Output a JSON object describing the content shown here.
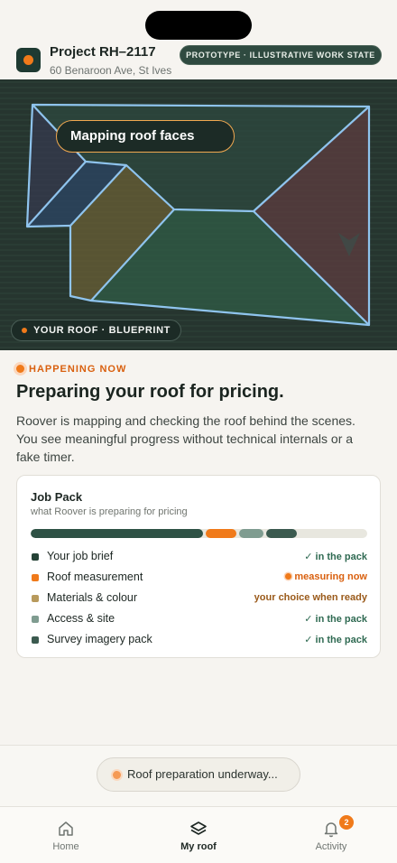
{
  "header": {
    "project_title": "Project RH–2117",
    "address": "60 Benaroon Ave, St Ives",
    "prototype_badge": "PROTOTYPE · ILLUSTRATIVE WORK STATE"
  },
  "hero": {
    "overlay_label": "Mapping roof faces",
    "chip_label": "YOUR ROOF · BLUEPRINT"
  },
  "status": {
    "label": "HAPPENING NOW",
    "heading": "Preparing your roof for pricing.",
    "body": "Roover is mapping and checking the roof behind the scenes. You see meaningful progress without technical internals or a fake timer."
  },
  "job_pack": {
    "title": "Job Pack",
    "subtitle": "what Roover is preparing for pricing",
    "progress_segments": [
      {
        "name": "Your job brief",
        "share": 0.52,
        "color": "#2e5245"
      },
      {
        "name": "Roof measurement",
        "share": 0.1,
        "color": "#f07a1a"
      },
      {
        "name": "Access & site",
        "share": 0.08,
        "color": "#7f9c90"
      },
      {
        "name": "Survey imagery pack",
        "share": 0.1,
        "color": "#3b5a4f"
      }
    ],
    "items": [
      {
        "name": "Your job brief",
        "status": "in the pack",
        "status_icon": "check-icon",
        "dot_color": "#254236",
        "status_color": "#2f6a52"
      },
      {
        "name": "Roof measurement",
        "status": "measuring now",
        "status_icon": "pulse-dot-icon",
        "dot_color": "#f07a1a",
        "status_color": "#d9600f"
      },
      {
        "name": "Materials & colour",
        "status": "your choice when ready",
        "status_icon": "",
        "dot_color": "#b89a5c",
        "status_color": "#9a5a1a"
      },
      {
        "name": "Access & site",
        "status": "in the pack",
        "status_icon": "check-icon",
        "dot_color": "#7f9c90",
        "status_color": "#2f6a52"
      },
      {
        "name": "Survey imagery pack",
        "status": "in the pack",
        "status_icon": "check-icon",
        "dot_color": "#3b5a4f",
        "status_color": "#2f6a52"
      }
    ]
  },
  "footer": {
    "status_pill": "Roof preparation underway..."
  },
  "tabs": [
    {
      "label": "Home",
      "icon": "home-icon"
    },
    {
      "label": "My roof",
      "icon": "layers-icon",
      "active": true
    },
    {
      "label": "Activity",
      "icon": "bell-icon",
      "badge": "2"
    }
  ],
  "colors": {
    "accent": "#f07a1a",
    "brand_dark": "#1e3a32",
    "blueprint_line": "#8fc4ee"
  }
}
